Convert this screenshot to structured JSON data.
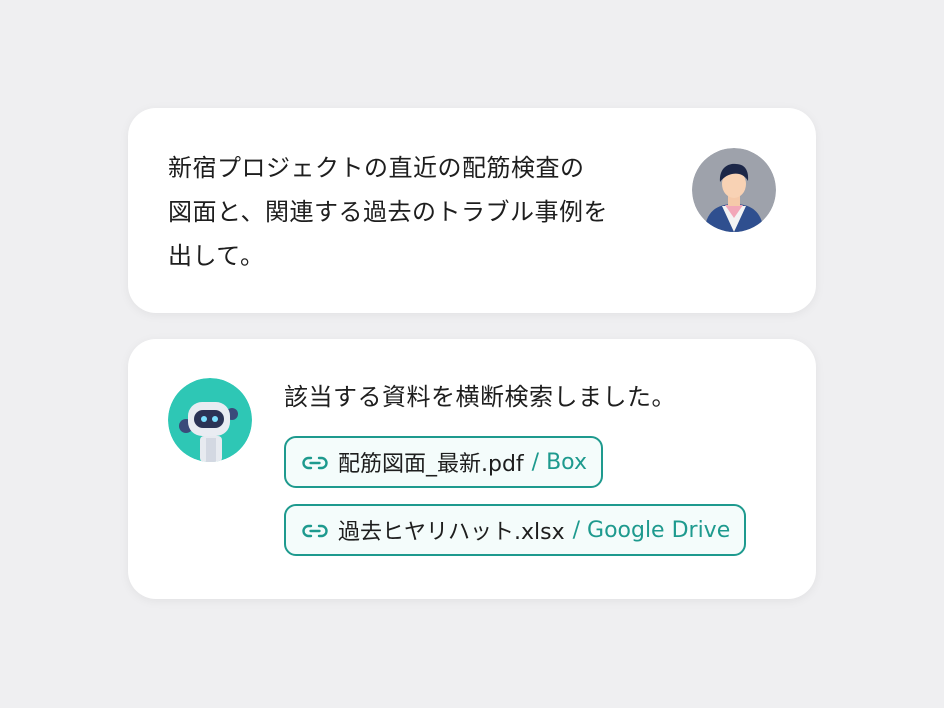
{
  "conversation": {
    "user_message": {
      "lines": [
        "新宿プロジェクトの直近の配筋検査の",
        "図面と、関連する過去のトラブル事例を",
        "出して。"
      ]
    },
    "assistant_message": {
      "text": "該当する資料を横断検索しました。",
      "attachments": [
        {
          "file_name": "配筋図面_最新.pdf",
          "source": "/ Box"
        },
        {
          "file_name": "過去ヒヤリハット.xlsx",
          "source": "/ Google Drive"
        }
      ]
    }
  },
  "icons": {
    "user_avatar": "person-avatar-icon",
    "assistant_avatar": "robot-avatar-icon",
    "attachment": "link-icon"
  },
  "colors": {
    "background": "#efeff1",
    "card": "#ffffff",
    "accent": "#1e9a8e",
    "text": "#1e1e1e"
  }
}
